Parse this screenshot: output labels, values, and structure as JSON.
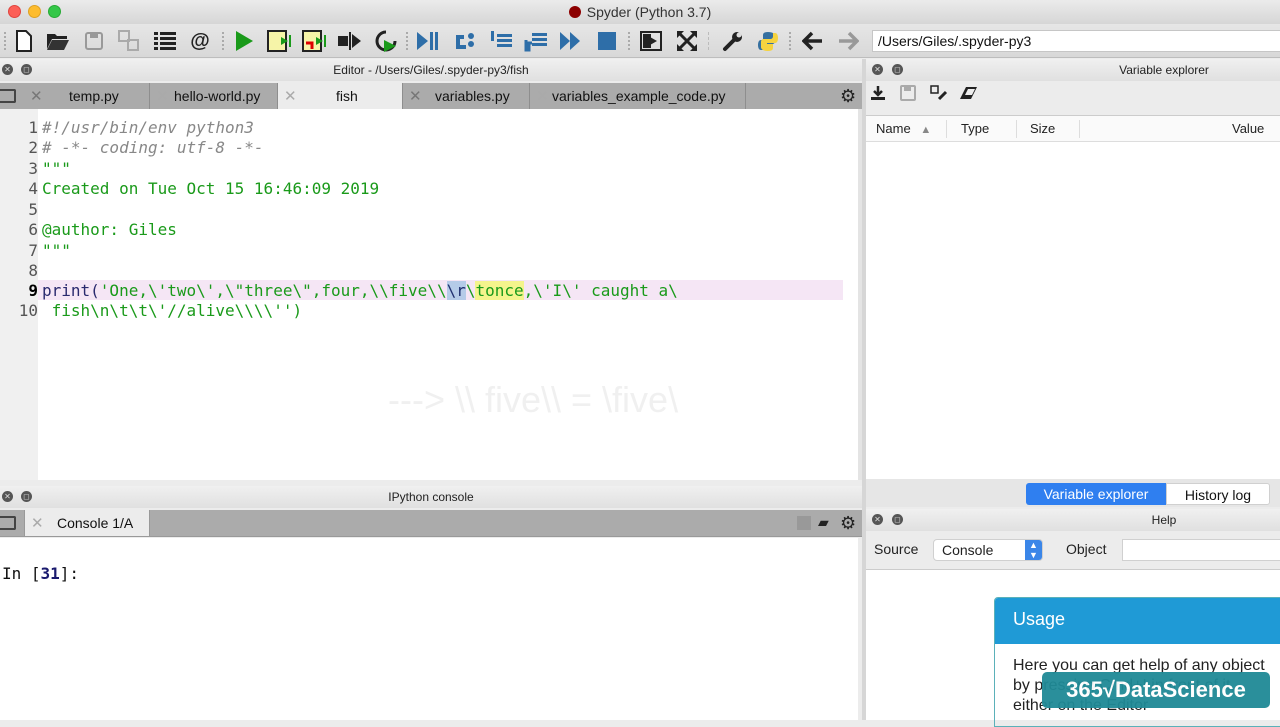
{
  "window": {
    "title": "Spyder (Python 3.7)"
  },
  "toolbar": {
    "icons": [
      "new-file",
      "open-file",
      "save-file",
      "save-all",
      "outline",
      "at-sign",
      "run",
      "run-cell",
      "run-cell-advance",
      "run-selection",
      "re-run",
      "debug",
      "step",
      "step-into",
      "step-return",
      "continue",
      "stop",
      "maximize-pane",
      "fullscreen",
      "preferences",
      "python-path",
      "back",
      "forward"
    ],
    "working_dir": "/Users/Giles/.spyder-py3"
  },
  "editor": {
    "header": "Editor - /Users/Giles/.spyder-py3/fish",
    "tabs": [
      {
        "label": "temp.py",
        "active": false
      },
      {
        "label": "hello-world.py",
        "active": false
      },
      {
        "label": "fish",
        "active": true
      },
      {
        "label": "variables.py",
        "active": false
      },
      {
        "label": "variables_example_code.py",
        "active": false
      }
    ],
    "current_line": 9,
    "lines": [
      {
        "n": "1",
        "text": "#!/usr/bin/env python3"
      },
      {
        "n": "2",
        "text": "# -*- coding: utf-8 -*-"
      },
      {
        "n": "3",
        "text": "\"\"\""
      },
      {
        "n": "4",
        "text": "Created on Tue Oct 15 16:46:09 2019"
      },
      {
        "n": "5",
        "text": ""
      },
      {
        "n": "6",
        "text": "@author: Giles"
      },
      {
        "n": "7",
        "text": "\"\"\""
      },
      {
        "n": "8",
        "text": ""
      },
      {
        "n": "9",
        "text_kw": "print(",
        "text_a": "'One,\\'two\\',\\\"three\\\",four,\\\\five\\\\",
        "text_sel": "\\r",
        "text_b": "\\",
        "text_match": "tonce",
        "text_c": ",\\'I\\' caught a\\"
      },
      {
        "n": "10",
        "text": " fish\\n\\t\\t\\'//alive\\\\\\\\'')"
      }
    ],
    "overlay_annotation": "---> \\\\ five\\\\  = \\five\\"
  },
  "console": {
    "header": "IPython console",
    "tabs": [
      {
        "label": "Console 1/A",
        "active": true
      }
    ],
    "prompt_prefix": "In [",
    "prompt_number": "31",
    "prompt_suffix": "]:"
  },
  "variable_explorer": {
    "header": "Variable explorer",
    "columns": [
      "Name",
      "Type",
      "Size",
      "Value"
    ],
    "sort_indicator": "▲",
    "rows": []
  },
  "right_tabs": [
    {
      "label": "Variable explorer",
      "active": true
    },
    {
      "label": "History log",
      "active": false
    }
  ],
  "help": {
    "header": "Help",
    "source_label": "Source",
    "source_value": "Console",
    "object_label": "Object",
    "object_value": "",
    "usage_title": "Usage",
    "usage_text": "Here you can get help of any object by pressing Cmd+I in front of it, either on the Editor"
  },
  "watermark": {
    "brand": "365√DataScience"
  },
  "colors": {
    "string_green": "#1a9a1a",
    "active_tab_blue": "#2f7ff0",
    "usage_header": "#1f9ad6",
    "brand_teal": "#1f8a96"
  }
}
